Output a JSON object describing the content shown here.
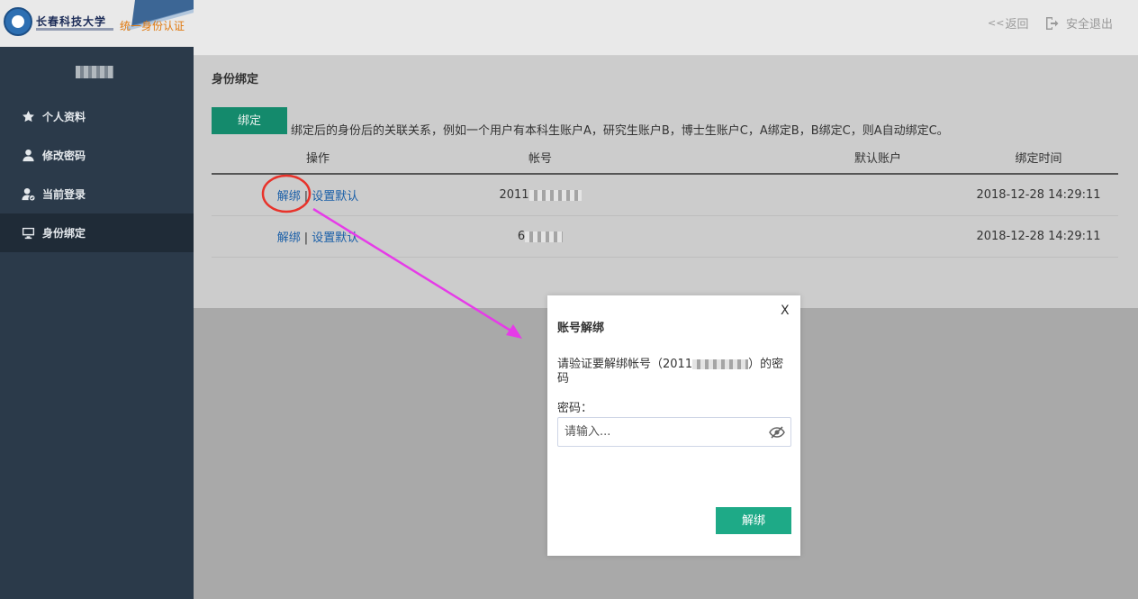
{
  "brand": {
    "school_name": "长春科技大学",
    "system_name": "统一身份认证"
  },
  "header": {
    "back_prefix": "<<",
    "back_label": "返回",
    "logout_label": "安全退出"
  },
  "sidebar": {
    "items": [
      {
        "label": "个人资料",
        "icon": "star-icon"
      },
      {
        "label": "修改密码",
        "icon": "user-icon"
      },
      {
        "label": "当前登录",
        "icon": "user-check-icon"
      },
      {
        "label": "身份绑定",
        "icon": "monitor-icon",
        "active": true
      }
    ]
  },
  "main": {
    "section_title": "身份绑定",
    "bind_button": "绑定",
    "bind_note": "绑定后的身份后的关联关系，例如一个用户有本科生账户A，研究生账户B，博士生账户C，A绑定B，B绑定C，则A自动绑定C。",
    "table": {
      "headers": [
        "操作",
        "帐号",
        "默认账户",
        "绑定时间"
      ],
      "rows": [
        {
          "unbind": "解绑",
          "separator": "|",
          "set_default": "设置默认",
          "account_prefix": "2011",
          "default": "",
          "time": "2018-12-28 14:29:11"
        },
        {
          "unbind": "解绑",
          "separator": "|",
          "set_default": "设置默认",
          "account_prefix": "6",
          "default": "",
          "time": "2018-12-28 14:29:11"
        }
      ]
    }
  },
  "modal": {
    "close": "X",
    "title": "账号解绑",
    "message_before": "请验证要解绑帐号（2011",
    "message_after": "）的密码",
    "password_label": "密码：",
    "password_placeholder": "请输入...",
    "submit": "解绑",
    "eye_icon": "eye-off-icon"
  },
  "annotation": {
    "circle_color": "#e8322a",
    "arrow_color": "#e63be8"
  }
}
